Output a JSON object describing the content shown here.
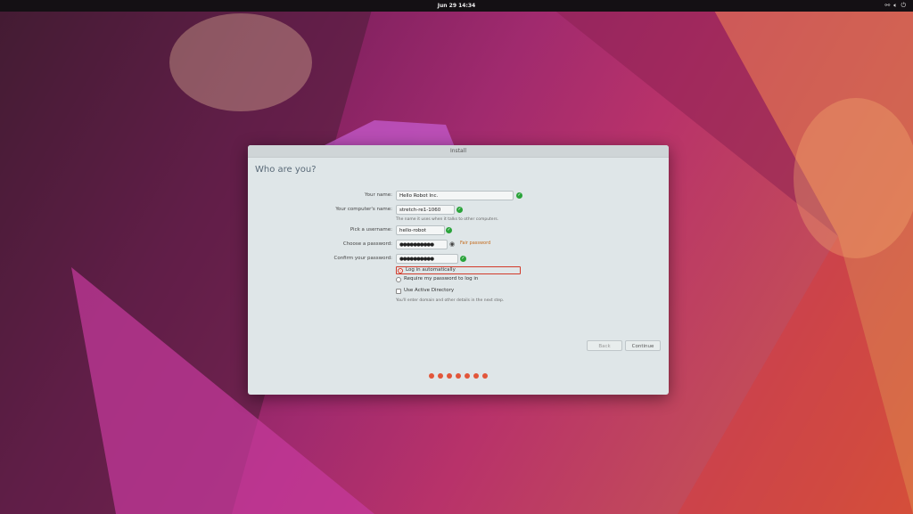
{
  "topbar": {
    "clock": "Jun 29  14:34",
    "tray_icons": [
      "network-icon",
      "volume-icon",
      "power-icon"
    ]
  },
  "window": {
    "title": "Install",
    "heading": "Who are you?",
    "fields": {
      "name_label": "Your name:",
      "name_value": "Hello Robot Inc.",
      "computer_label": "Your computer's name:",
      "computer_value": "stretch-re1-1060",
      "computer_hint": "The name it uses when it talks to other computers.",
      "user_label": "Pick a username:",
      "user_value": "hello-robot",
      "password_label": "Choose a password:",
      "password_value": "●●●●●●●●●●",
      "password_strength": "Fair password",
      "confirm_label": "Confirm your password:",
      "confirm_value": "●●●●●●●●●●"
    },
    "options": {
      "auto_login": "Log in automatically",
      "require_password": "Require my password to log in",
      "active_directory": "Use Active Directory",
      "ad_hint": "You'll enter domain and other details in the next step."
    },
    "buttons": {
      "back": "Back",
      "continue": "Continue"
    },
    "progress_dots": 7
  },
  "colors": {
    "accent": "#e2563a",
    "ok": "#2aa33a",
    "dialog_bg": "#dfe6e8"
  }
}
